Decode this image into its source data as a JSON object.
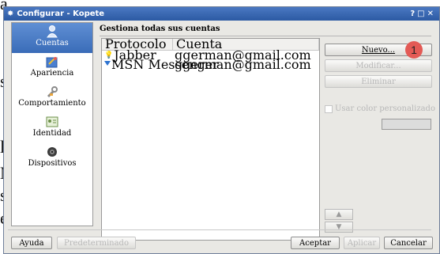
{
  "background_text": [
    "a",
    "s",
    "l",
    "M",
    "s",
    "e"
  ],
  "window": {
    "title": "Configurar - Kopete",
    "controls": "?□✕"
  },
  "sidebar": {
    "items": [
      {
        "label": "Cuentas",
        "icon": "user-icon",
        "selected": true
      },
      {
        "label": "Apariencia",
        "icon": "appearance-icon",
        "selected": false
      },
      {
        "label": "Comportamiento",
        "icon": "wrench-icon",
        "selected": false
      },
      {
        "label": "Identidad",
        "icon": "identity-card-icon",
        "selected": false
      },
      {
        "label": "Dispositivos",
        "icon": "speaker-icon",
        "selected": false
      }
    ]
  },
  "main": {
    "heading": "Gestiona todas sus cuentas",
    "columns": [
      "Protocolo",
      "Cuenta"
    ],
    "rows": [
      {
        "protocol": "Jabber",
        "account": "ggerman@gmail.com",
        "icon": "jabber-icon"
      },
      {
        "protocol": "MSN Messenger",
        "account": "ggerman@gmail.com",
        "icon": "msn-icon"
      }
    ]
  },
  "side_buttons": {
    "new": "Nuevo...",
    "modify": "Modificar...",
    "delete": "Eliminar"
  },
  "custom_color": {
    "label": "Usar color personalizado",
    "checked": false
  },
  "badge": "1",
  "bottom": {
    "help": "Ayuda",
    "default": "Predeterminado",
    "accept": "Aceptar",
    "apply": "Aplicar",
    "cancel": "Cancelar"
  },
  "colors": {
    "accent": "#3a6cb8",
    "badge": "#e35a55"
  }
}
